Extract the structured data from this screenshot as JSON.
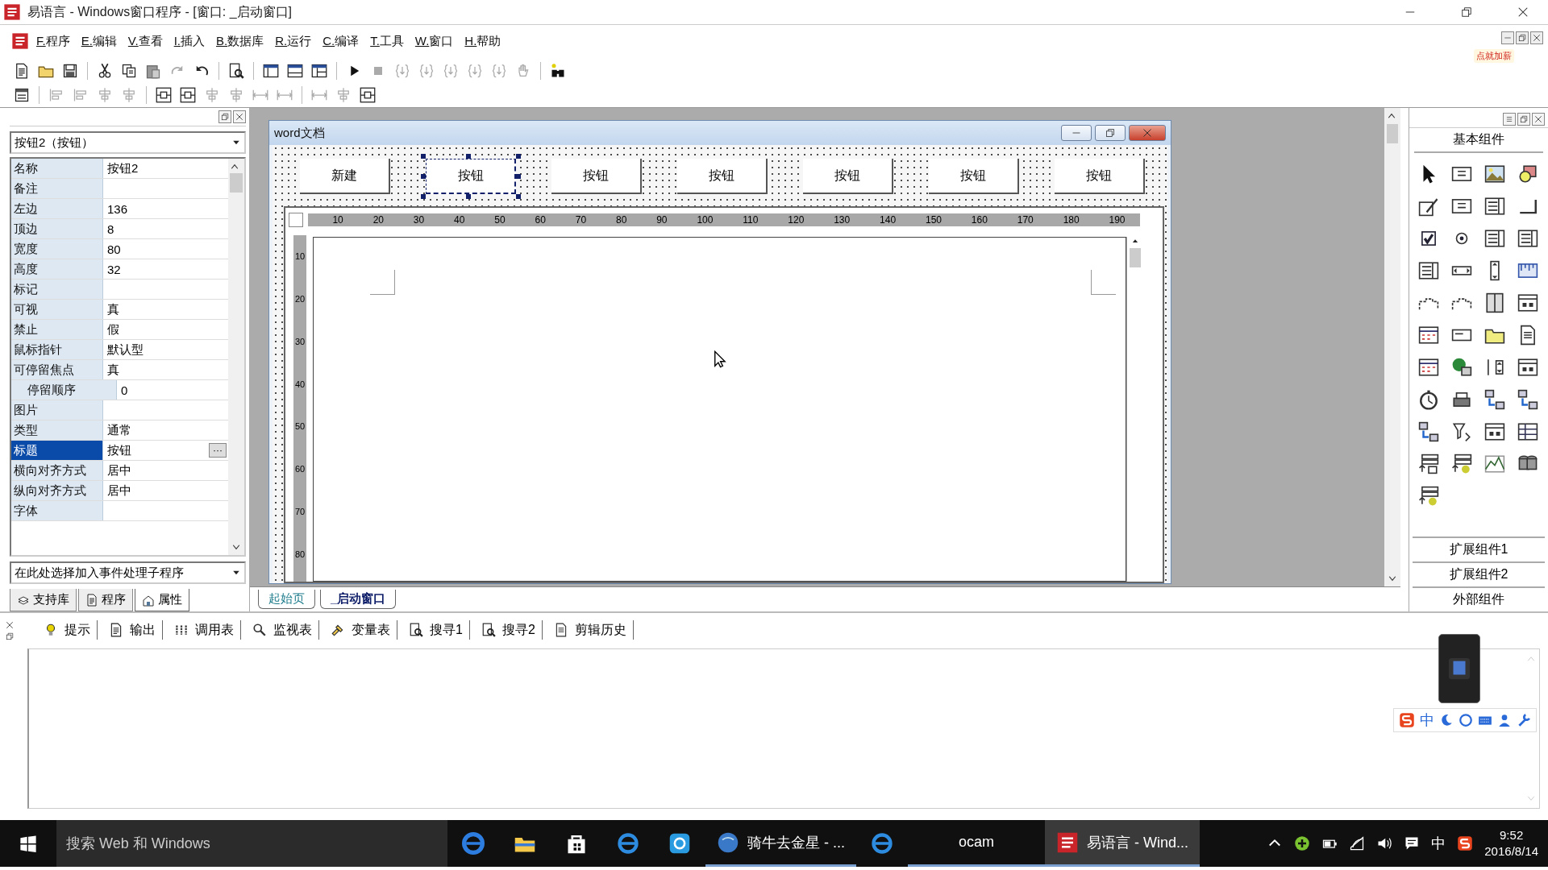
{
  "window": {
    "title": "易语言 - Windows窗口程序 - [窗口: _启动窗口]"
  },
  "menu": [
    {
      "label": "F.程序"
    },
    {
      "label": "E.编辑"
    },
    {
      "label": "V.查看"
    },
    {
      "label": "I.插入"
    },
    {
      "label": "B.数据库"
    },
    {
      "label": "R.运行"
    },
    {
      "label": "C.编译"
    },
    {
      "label": "T.工具"
    },
    {
      "label": "W.窗口"
    },
    {
      "label": "H.帮助"
    }
  ],
  "ad_badge": "点就加薪",
  "properties": {
    "selector": "按钮2（按钮）",
    "rows": [
      {
        "name": "名称",
        "value": "按钮2",
        "selected": false
      },
      {
        "name": "备注",
        "value": "",
        "selected": false
      },
      {
        "name": "左边",
        "value": "136",
        "selected": false
      },
      {
        "name": "顶边",
        "value": "8",
        "selected": false
      },
      {
        "name": "宽度",
        "value": "80",
        "selected": false
      },
      {
        "name": "高度",
        "value": "32",
        "selected": false
      },
      {
        "name": "标记",
        "value": "",
        "selected": false
      },
      {
        "name": "可视",
        "value": "真",
        "selected": false
      },
      {
        "name": "禁止",
        "value": "假",
        "selected": false
      },
      {
        "name": "鼠标指针",
        "value": "默认型",
        "selected": false
      },
      {
        "name": "可停留焦点",
        "value": "真",
        "selected": false,
        "children": [
          {
            "name": "停留顺序",
            "value": "0",
            "selected": false
          }
        ]
      },
      {
        "name": "图片",
        "value": "",
        "selected": false
      },
      {
        "name": "类型",
        "value": "通常",
        "selected": false
      },
      {
        "name": "标题",
        "value": "按钮",
        "selected": true,
        "button": "···"
      },
      {
        "name": "横向对齐方式",
        "value": "居中",
        "selected": false
      },
      {
        "name": "纵向对齐方式",
        "value": "居中",
        "selected": false
      },
      {
        "name": "字体",
        "value": "",
        "selected": false
      }
    ],
    "event_selector": "在此处选择加入事件处理子程序",
    "tabs": [
      {
        "label": "支持库",
        "selected": false
      },
      {
        "label": "程序",
        "selected": false
      },
      {
        "label": "属性",
        "selected": true
      }
    ]
  },
  "designer": {
    "form_title": "word文档",
    "buttons": [
      {
        "label": "新建",
        "selected": false
      },
      {
        "label": "按钮",
        "selected": true
      },
      {
        "label": "按钮",
        "selected": false
      },
      {
        "label": "按钮",
        "selected": false
      },
      {
        "label": "按钮",
        "selected": false
      },
      {
        "label": "按钮",
        "selected": false
      },
      {
        "label": "按钮",
        "selected": false
      }
    ],
    "ruler_h": [
      "10",
      "20",
      "30",
      "40",
      "50",
      "60",
      "70",
      "80",
      "90",
      "100",
      "110",
      "120",
      "130",
      "140",
      "150",
      "160",
      "170",
      "180",
      "190"
    ],
    "ruler_v": [
      "10",
      "20",
      "30",
      "40",
      "50",
      "60",
      "70",
      "80"
    ],
    "tabs": [
      {
        "label": "起始页",
        "selected": false
      },
      {
        "label": "_启动窗口",
        "selected": true
      }
    ]
  },
  "components": {
    "title": "基本组件",
    "sections": [
      "扩展组件1",
      "扩展组件2",
      "外部组件"
    ]
  },
  "output": {
    "tabs": [
      {
        "label": "提示",
        "selected": false
      },
      {
        "label": "输出",
        "selected": false
      },
      {
        "label": "调用表",
        "selected": false
      },
      {
        "label": "监视表",
        "selected": false
      },
      {
        "label": "变量表",
        "selected": false
      },
      {
        "label": "搜寻1",
        "selected": false
      },
      {
        "label": "搜寻2",
        "selected": false
      },
      {
        "label": "剪辑历史",
        "selected": false
      }
    ],
    "ime": "中"
  },
  "taskbar": {
    "search_placeholder": "搜索 Web 和 Windows",
    "apps": [
      {
        "label": "骑牛去金星 - ...",
        "selected": false
      },
      {
        "label": "ocam",
        "selected": false
      },
      {
        "label": "易语言 - Wind...",
        "selected": true
      }
    ],
    "ime": "中",
    "time": "9:52",
    "date": "2016/8/14"
  }
}
